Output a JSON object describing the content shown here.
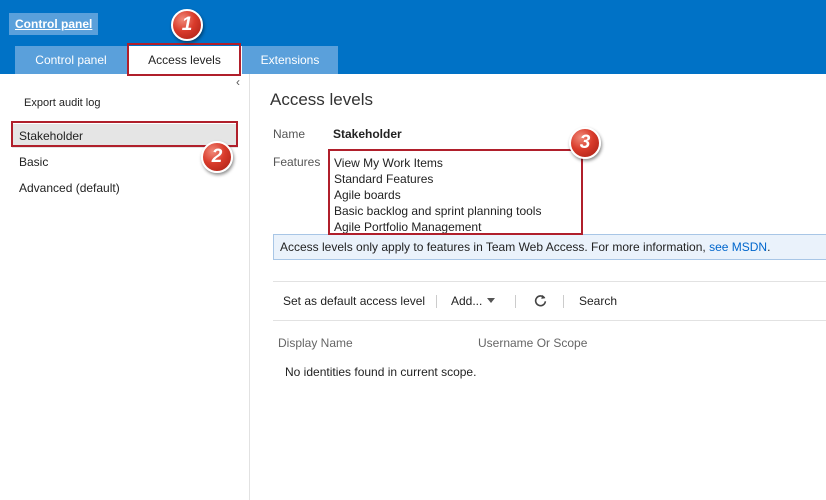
{
  "header": {
    "app_title": "Control panel",
    "tabs": [
      {
        "label": "Control panel"
      },
      {
        "label": "Access levels"
      },
      {
        "label": "Extensions"
      }
    ]
  },
  "sidebar": {
    "collapse_icon": "chevron-left-icon",
    "export_label": "Export audit log",
    "levels": [
      {
        "label": "Stakeholder",
        "selected": true
      },
      {
        "label": "Basic"
      },
      {
        "label": "Advanced (default)"
      }
    ]
  },
  "main": {
    "title": "Access levels",
    "name_label": "Name",
    "name_value": "Stakeholder",
    "features_label": "Features",
    "features": [
      "View My Work Items",
      "Standard Features",
      "Agile boards",
      "Basic backlog and sprint planning tools",
      "Agile Portfolio Management"
    ],
    "info_text": "Access levels only apply to features in Team Web Access. For more information, ",
    "info_link": "see MSDN",
    "info_end": ".",
    "toolbar": {
      "set_default": "Set as default access level",
      "add": "Add...",
      "refresh_icon": "refresh-icon",
      "search": "Search"
    },
    "columns": [
      "Display Name",
      "Username Or Scope"
    ],
    "empty_message": "No identities found in current scope."
  },
  "callouts": [
    "1",
    "2",
    "3"
  ],
  "colors": {
    "header_bg": "#0072c6",
    "tab_bg": "#5aa0db",
    "callout_red": "#b01f2b",
    "link_blue": "#0066cc"
  }
}
